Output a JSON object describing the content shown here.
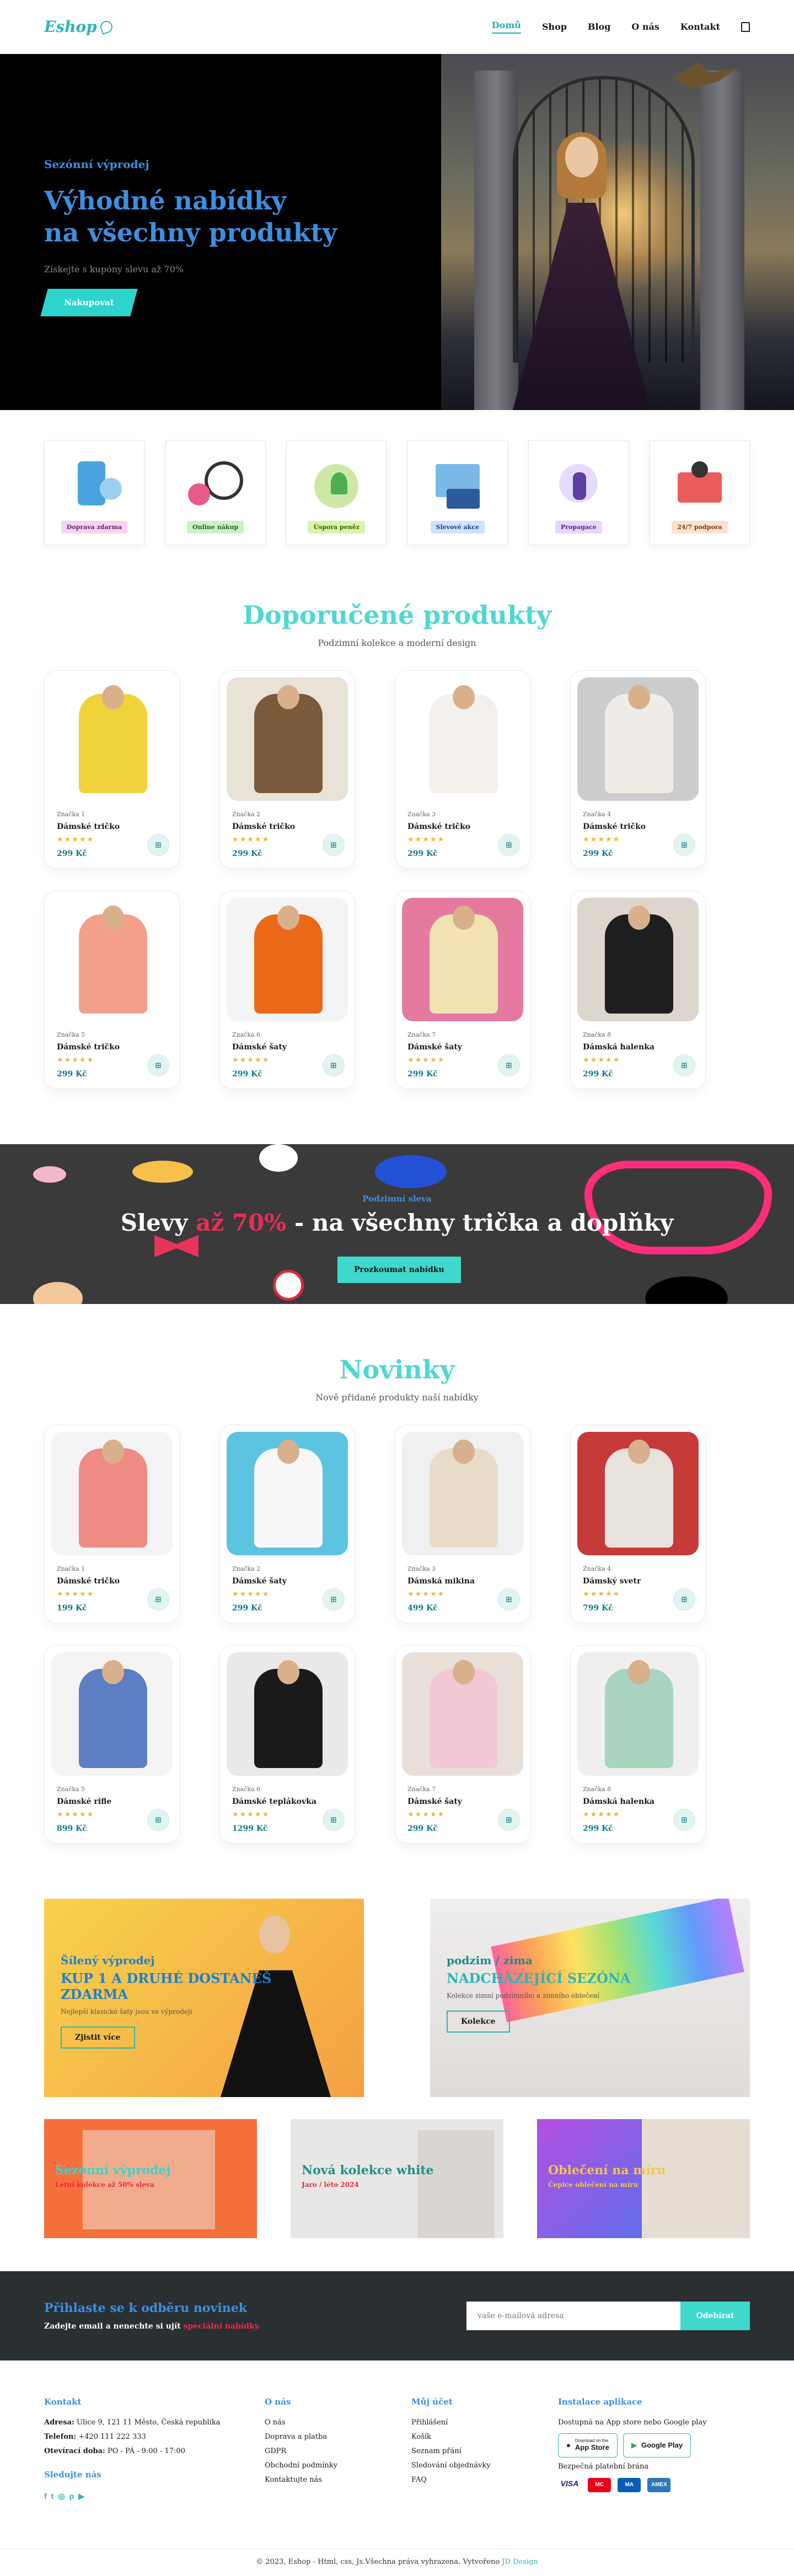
{
  "header": {
    "logo": "Eshop",
    "nav": [
      "Domů",
      "Shop",
      "Blog",
      "O nás",
      "Kontakt"
    ],
    "active_nav": "Domů"
  },
  "hero": {
    "kicker": "Sezónní výprodej",
    "title_line1": "Výhodné nabídky",
    "title_line2": "na všechny produkty",
    "subtitle": "Získejte s kupóny slevu až 70%",
    "cta": "Nakupovat"
  },
  "features": [
    {
      "label": "Doprava zdarma",
      "color": "#f6d4ec",
      "text": "#5a2b6f"
    },
    {
      "label": "Online nákup",
      "color": "#cdf0c9",
      "text": "#2c5b26"
    },
    {
      "label": "Úspora peněz",
      "color": "#d8f5a8",
      "text": "#3a5b12"
    },
    {
      "label": "Slevové akce",
      "color": "#cfe2ff",
      "text": "#1e3f80"
    },
    {
      "label": "Propagace",
      "color": "#e7d6ff",
      "text": "#4a2d7a"
    },
    {
      "label": "24/7 podpora",
      "color": "#ffe0cc",
      "text": "#7a3d12"
    }
  ],
  "featured": {
    "title": "Doporučené produkty",
    "subtitle": "Podzimní kolekce a moderní design",
    "products": [
      {
        "brand": "Značka 1",
        "name": "Dámské tričko",
        "price": "299 Kč",
        "stars": "★★★★★"
      },
      {
        "brand": "Značka 2",
        "name": "Dámské tričko",
        "price": "299 Kč",
        "stars": "★★★★★"
      },
      {
        "brand": "Značka 3",
        "name": "Dámské tričko",
        "price": "299 Kč",
        "stars": "★★★★★"
      },
      {
        "brand": "Značka 4",
        "name": "Dámské tričko",
        "price": "299 Kč",
        "stars": "★★★★★"
      },
      {
        "brand": "Značka 5",
        "name": "Dámské tričko",
        "price": "299 Kč",
        "stars": "★★★★★"
      },
      {
        "brand": "Značka 6",
        "name": "Dámské šaty",
        "price": "299 Kč",
        "stars": "★★★★★"
      },
      {
        "brand": "Značka 7",
        "name": "Dámské šaty",
        "price": "299 Kč",
        "stars": "★★★★★"
      },
      {
        "brand": "Značka 8",
        "name": "Dámská halenka",
        "price": "299 Kč",
        "stars": "★★★★★"
      }
    ]
  },
  "banner": {
    "tag": "Podzimní sleva",
    "title_pre": "Slevy ",
    "title_em": "až 70%",
    "title_post": " - na všechny trička a doplňky",
    "cta": "Prozkoumat nabídku"
  },
  "new": {
    "title": "Novinky",
    "subtitle": "Nově přidané produkty naší nabídky",
    "products": [
      {
        "brand": "Značka 1",
        "name": "Dámské tričko",
        "price": "199 Kč",
        "stars": "★★★★★"
      },
      {
        "brand": "Značka 2",
        "name": "Dámské šaty",
        "price": "299 Kč",
        "stars": "★★★★★"
      },
      {
        "brand": "Značka 3",
        "name": "Dámská mikina",
        "price": "499 Kč",
        "stars": "★★★★★"
      },
      {
        "brand": "Značka 4",
        "name": "Dámský svetr",
        "price": "799 Kč",
        "stars": "★★★★★"
      },
      {
        "brand": "Značka 5",
        "name": "Dámské riflе",
        "price": "899 Kč",
        "stars": "★★★★★"
      },
      {
        "brand": "Značka 6",
        "name": "Dámské teplákovka",
        "price": "1299 Kč",
        "stars": "★★★★★"
      },
      {
        "brand": "Značka 7",
        "name": "Dámské šaty",
        "price": "299 Kč",
        "stars": "★★★★★"
      },
      {
        "brand": "Značka 8",
        "name": "Dámská halenka",
        "price": "299 Kč",
        "stars": "★★★★★"
      }
    ]
  },
  "promos": {
    "big": [
      {
        "kicker": "Šílený výprodej",
        "title": "KUP 1 A DRUHÉ DOSTANEŠ ZDARMA",
        "text": "Nejlepší klasické šaty jsou ve výprodeji",
        "cta": "Zjistit více"
      },
      {
        "kicker": "podzim / zima",
        "title": "NADCHÁZEJÍCÍ SEZÓNA",
        "text": "Kolekce zimní podzimního a zimního oblečení",
        "cta": "Kolekce"
      }
    ],
    "small": [
      {
        "title": "Sezónní výprodej",
        "text": "Letní kolekce až 50% sleva"
      },
      {
        "title": "Nová kolekce white",
        "text": "Jaro / léto 2024"
      },
      {
        "title": "Oblečení na míru",
        "text": "Čepice oblečení na míru"
      }
    ]
  },
  "newsletter": {
    "title": "Přihlaste se k odběru novinek",
    "text_pre": "Zadejte email a nenechte si ujít ",
    "text_em": "speciální nabídky.",
    "placeholder": "vaše e-mailová adresa",
    "button": "Odebírat"
  },
  "footer": {
    "contact": {
      "title": "Kontakt",
      "address_label": "Adresa:",
      "address": "Ulice 9, 121 11 Město, Česká republika",
      "phone_label": "Telefon:",
      "phone": "+420 111 222 333",
      "hours_label": "Otevírací doba:",
      "hours": "PO - PÁ - 9:00 - 17:00",
      "social_title": "Sledujte nás"
    },
    "about": {
      "title": "O nás",
      "links": [
        "O nás",
        "Doprava a platba",
        "GDPR",
        "Obchodní podmínky",
        "Kontaktujte nás"
      ]
    },
    "account": {
      "title": "Můj účet",
      "links": [
        "Přihlášení",
        "Košík",
        "Seznam přání",
        "Sledování objednávky",
        "FAQ"
      ]
    },
    "app": {
      "title": "Instalace aplikace",
      "text": "Dostupná na App store nebo Google play",
      "appstore": "App Store",
      "appstore_small": "Download on the",
      "googleplay": "Google Play",
      "payments": "Bezpečná platební brána"
    },
    "copyright": "© 2023, Eshop - Html, css, Js.Všechna práva vyhrazena. Vytvořeno ",
    "copyright_link": "JD Design"
  }
}
